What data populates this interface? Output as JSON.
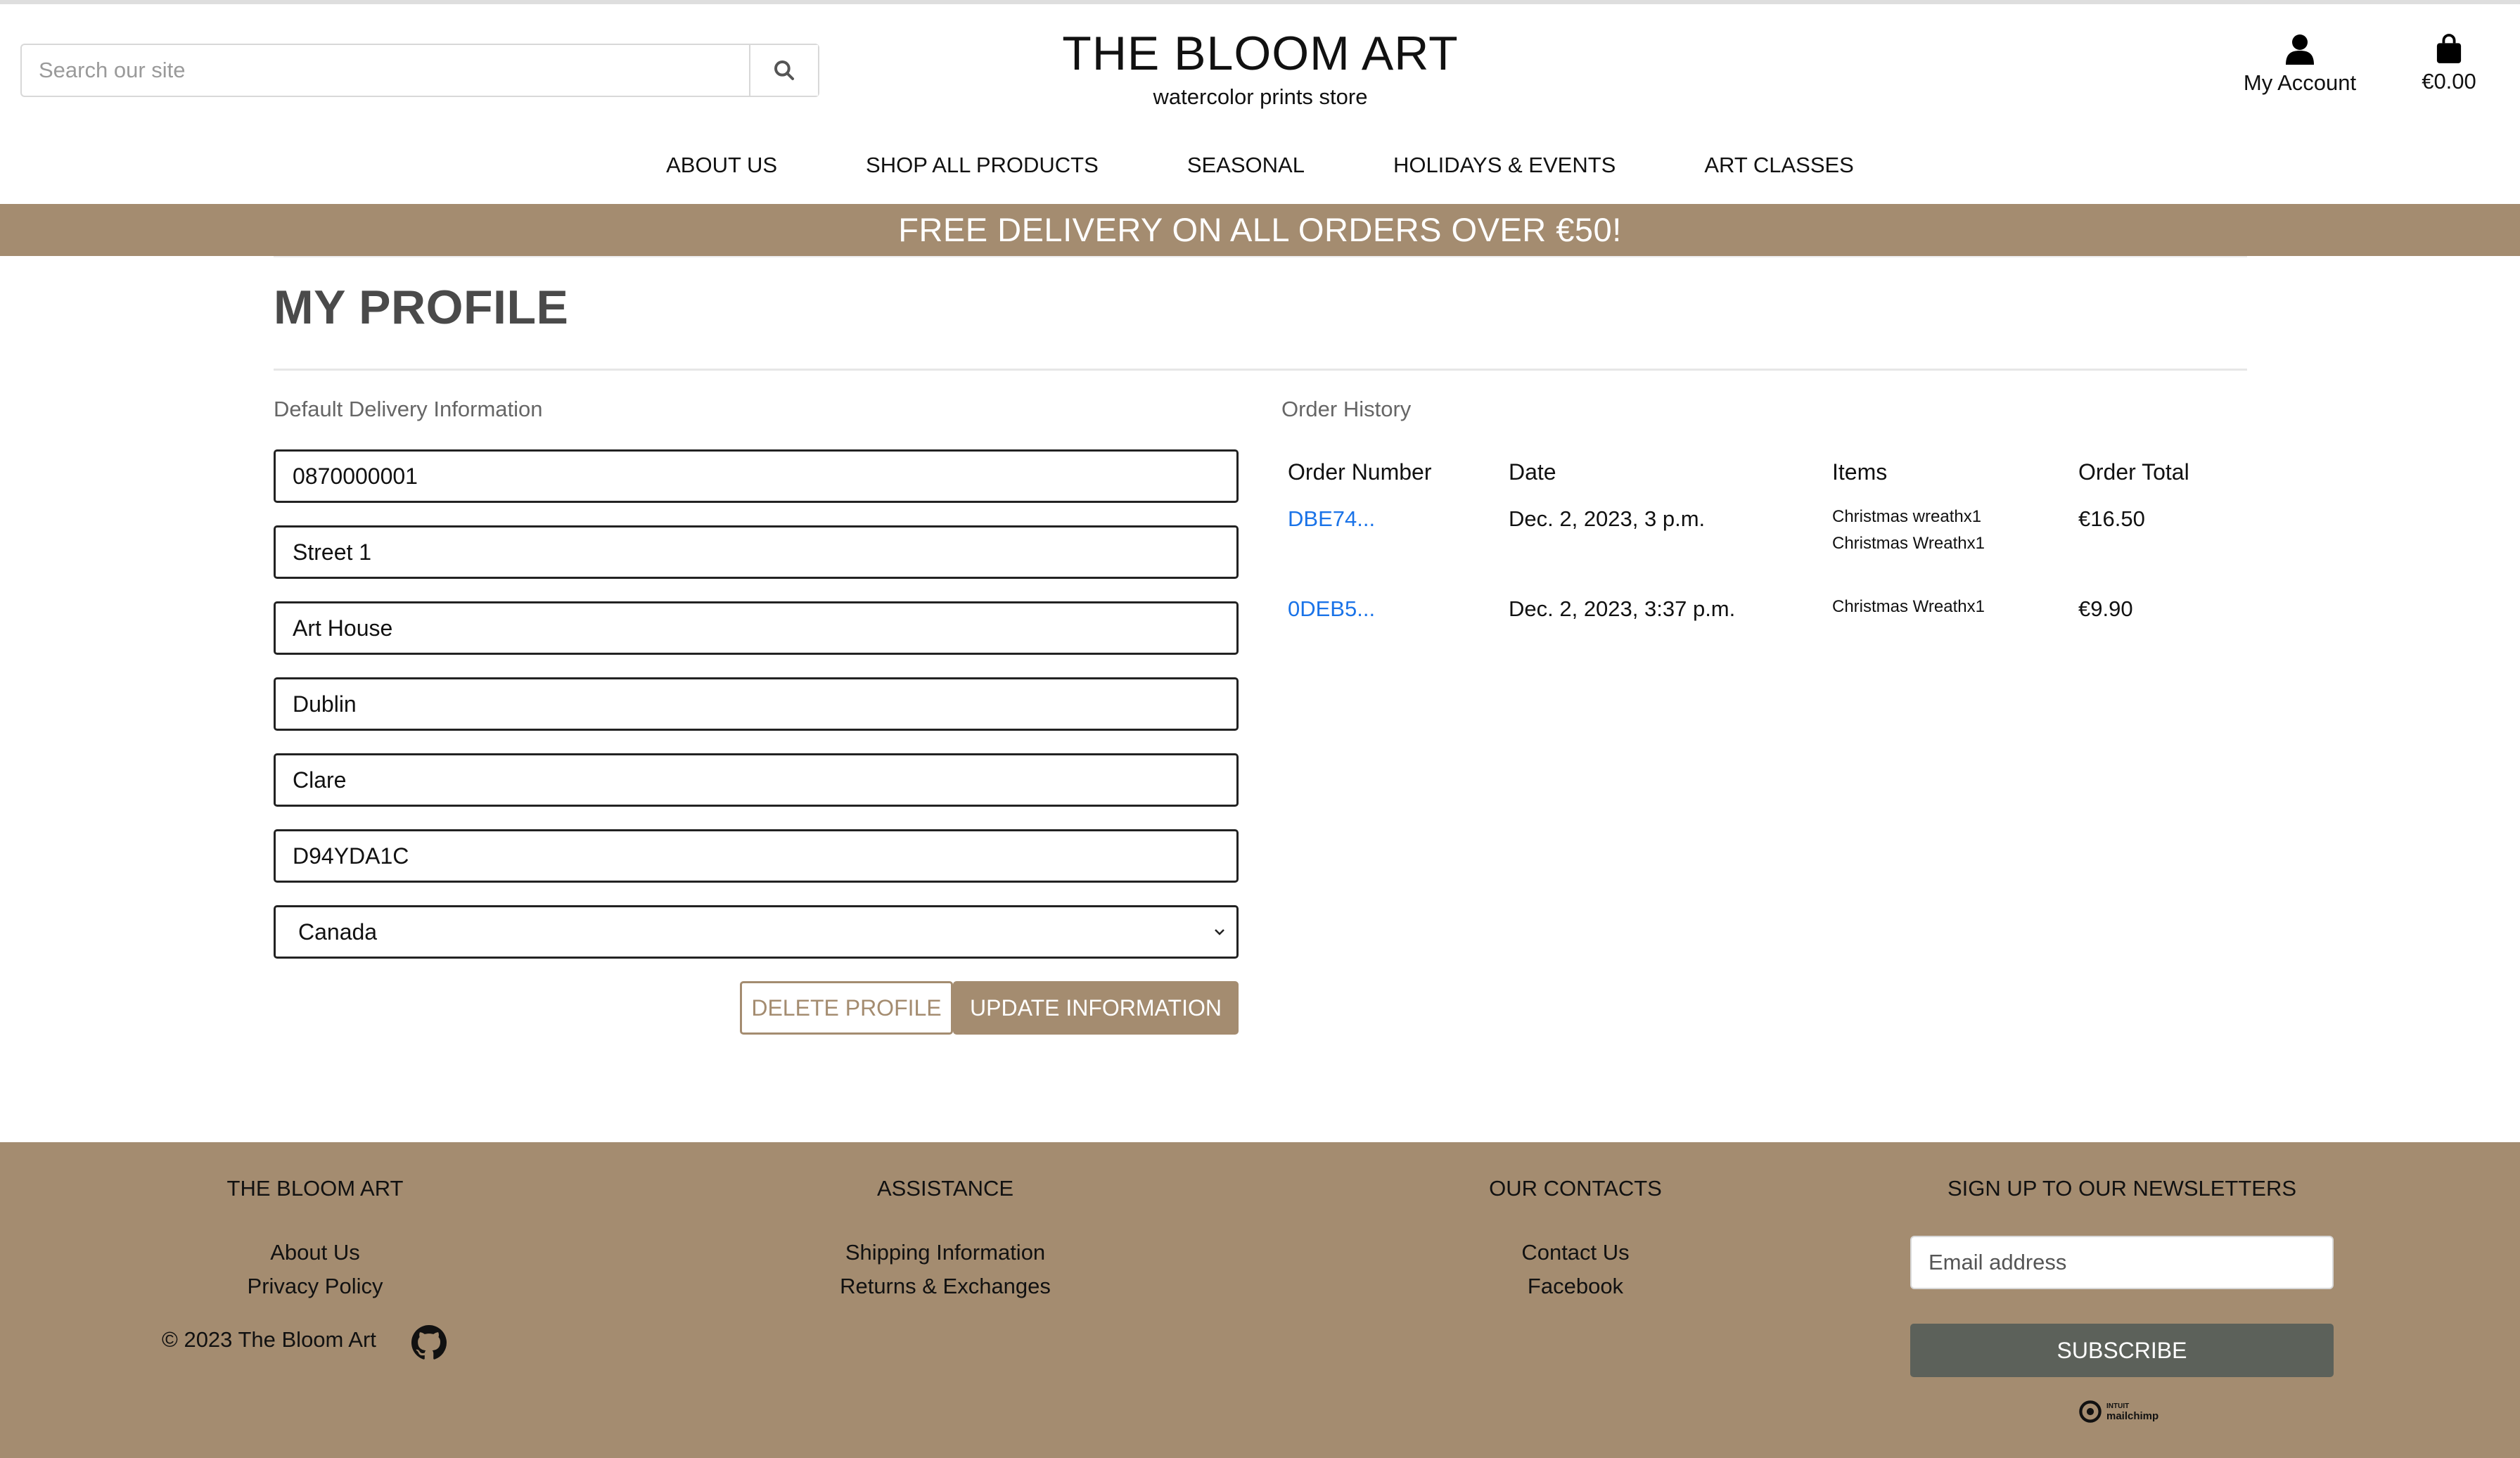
{
  "header": {
    "search_placeholder": "Search our site",
    "brand_title": "THE BLOOM ART",
    "brand_subtitle": "watercolor prints store",
    "account_label": "My Account",
    "cart_total": "€0.00"
  },
  "nav": [
    "ABOUT US",
    "SHOP ALL PRODUCTS",
    "SEASONAL",
    "HOLIDAYS & EVENTS",
    "ART CLASSES"
  ],
  "banner": "FREE DELIVERY ON ALL ORDERS OVER €50!",
  "profile": {
    "title": "MY PROFILE",
    "delivery_label": "Default Delivery Information",
    "phone": "0870000001",
    "street1": "Street 1",
    "street2": "Art House",
    "town": "Dublin",
    "county": "Clare",
    "postcode": "D94YDA1C",
    "country": "Canada",
    "delete_label": "DELETE PROFILE",
    "update_label": "UPDATE INFORMATION"
  },
  "orders": {
    "label": "Order History",
    "headers": [
      "Order Number",
      "Date",
      "Items",
      "Order Total"
    ],
    "rows": [
      {
        "number": "DBE74...",
        "date": "Dec. 2, 2023, 3 p.m.",
        "items": [
          "Christmas wreathx1",
          "Christmas Wreathx1"
        ],
        "total": "€16.50"
      },
      {
        "number": "0DEB5...",
        "date": "Dec. 2, 2023, 3:37 p.m.",
        "items": [
          "Christmas Wreathx1"
        ],
        "total": "€9.90"
      }
    ]
  },
  "footer": {
    "col1_title": "THE BLOOM ART",
    "col1_links": [
      "About Us",
      "Privacy Policy"
    ],
    "copyright": "© 2023 The Bloom Art",
    "col2_title": "ASSISTANCE",
    "col2_links": [
      "Shipping Information",
      "Returns & Exchanges"
    ],
    "col3_title": "OUR CONTACTS",
    "col3_links": [
      "Contact Us",
      "Facebook"
    ],
    "col4_title": "SIGN UP TO OUR NEWSLETTERS",
    "email_placeholder": "Email address",
    "subscribe_label": "SUBSCRIBE",
    "mailchimp_top": "INTUIT",
    "mailchimp_bottom": "mailchimp"
  },
  "colors": {
    "accent": "#a48c70",
    "link": "#1a73e8",
    "subscribe": "#5c615a"
  }
}
